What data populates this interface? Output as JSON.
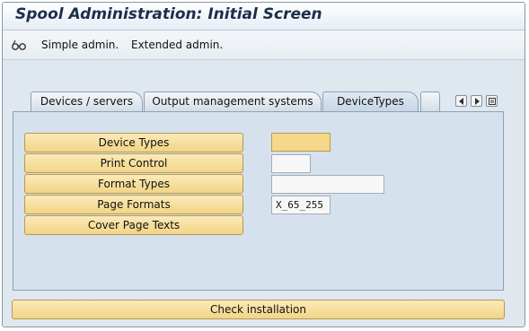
{
  "window": {
    "title": "Spool Administration: Initial Screen"
  },
  "toolbar": {
    "simple_admin": "Simple admin.",
    "extended_admin": "Extended admin."
  },
  "tabs": [
    {
      "label": "Devices / servers",
      "active": false
    },
    {
      "label": "Output management systems",
      "active": false
    },
    {
      "label": "DeviceTypes",
      "active": true
    }
  ],
  "device_types_panel": {
    "buttons": {
      "device_types": "Device Types",
      "print_control": "Print Control",
      "format_types": "Format Types",
      "page_formats": "Page Formats",
      "cover_page_texts": "Cover Page Texts"
    },
    "fields": {
      "device_type": "",
      "print_control": "",
      "format_type": "",
      "page_format": "X_65_255"
    }
  },
  "footer": {
    "check_installation": "Check installation"
  },
  "colors": {
    "button_yellow": "#f2d486",
    "required_field": "#f6d88a",
    "background": "#dfe7ef",
    "title_text": "#1b2f4a"
  }
}
